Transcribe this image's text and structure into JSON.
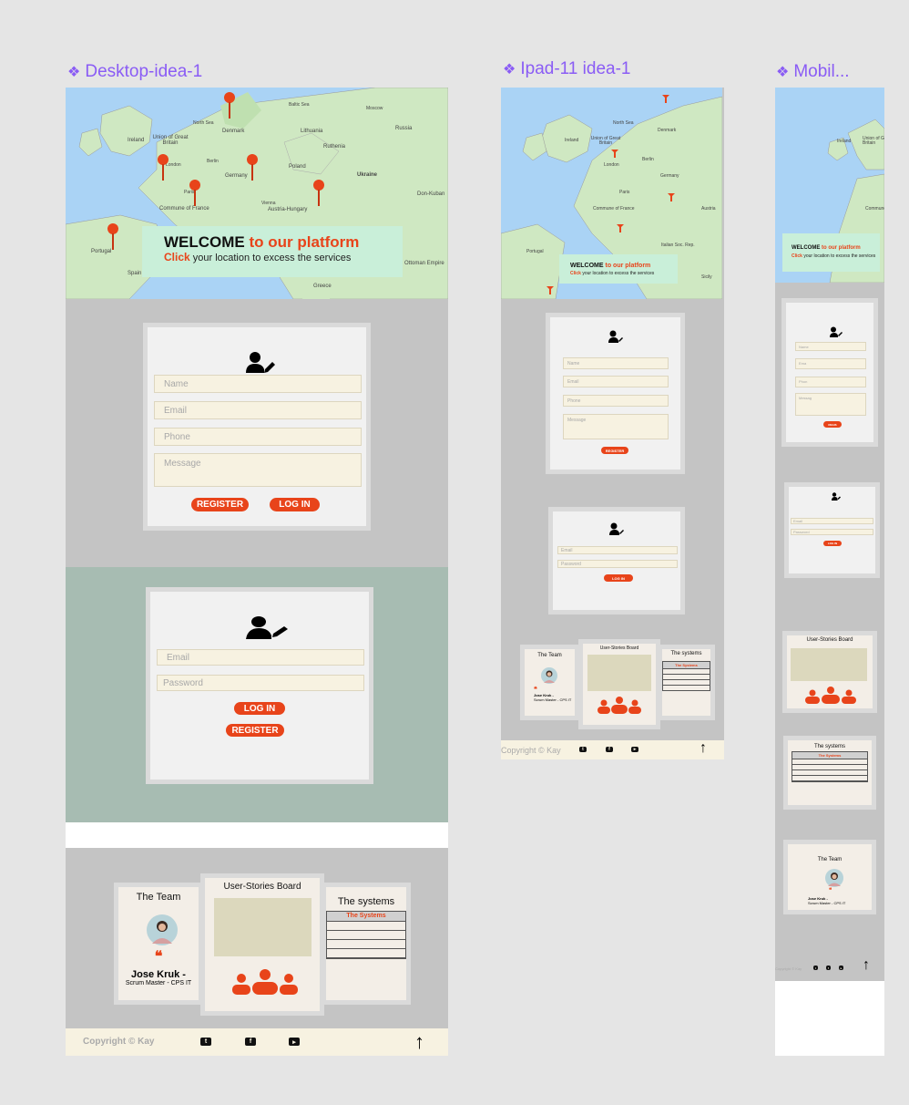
{
  "frames": {
    "desktop": {
      "label": "Desktop-idea-1"
    },
    "ipad": {
      "label": "Ipad-11 idea-1"
    },
    "mobile": {
      "label": "Mobil..."
    }
  },
  "map": {
    "labels": {
      "north_sea": "North Sea",
      "baltic_sea": "Baltic Sea",
      "ireland": "Ireland",
      "union_gb": "Union of Great Britain",
      "denmark": "Denmark",
      "lithuania": "Lithuania",
      "moscow": "Moscow",
      "russia": "Russia",
      "ruthenia": "Ruthenia",
      "london": "London",
      "poland": "Poland",
      "germany": "Germany",
      "berlin": "Berlin",
      "ukraine": "Ukraine",
      "paris": "Paris",
      "vienna": "Vienna",
      "commune_france": "Commune of France",
      "austria_hungary": "Austria-Hungary",
      "don_kuban": "Don-Kuban",
      "portugal": "Portugal",
      "spain": "Spain",
      "ottoman": "Ottoman Empire",
      "greece": "Greece",
      "italian_soc": "Italian Soc. Rep.",
      "sicily": "Sicily",
      "austria": "Austria"
    }
  },
  "welcome": {
    "title_main": "WELCOME",
    "title_accent": " to our platform",
    "sub_accent": "Click",
    "sub_text": " your location to excess the services"
  },
  "register_form": {
    "name_placeholder": "Name",
    "email_placeholder": "Email",
    "phone_placeholder": "Phone",
    "message_placeholder": "Message",
    "register_label": "REGISTER",
    "login_label": "LOG IN",
    "register_short": "REGIS"
  },
  "login_form": {
    "email_placeholder": "Email",
    "password_placeholder": "Password",
    "login_label": "LOG IN",
    "register_label": "REGISTER"
  },
  "mobile_fields": {
    "email_short": "Ema",
    "phone_short": "Phon",
    "message_short": "Messag"
  },
  "bottom_cards": {
    "team_title": "The Team",
    "quote": "❝",
    "member_name": "Jose Kruk -",
    "member_role": "Scrum Master - CPS IT",
    "board_title": "User-Stories Board",
    "systems_title": "The systems",
    "systems_header": "The Systems"
  },
  "footer": {
    "copyright": "Copyright © Kay",
    "twitter": "t",
    "facebook": "f",
    "youtube": "▸",
    "up_arrow": "↑"
  },
  "colors": {
    "accent": "#e8441a",
    "frame_label": "#8a5cf5",
    "welcome_bg": "#c9efd9",
    "section_grey": "#c4c4c4",
    "section_green": "#a7bcb2",
    "field_bg": "#f7f2e1"
  }
}
